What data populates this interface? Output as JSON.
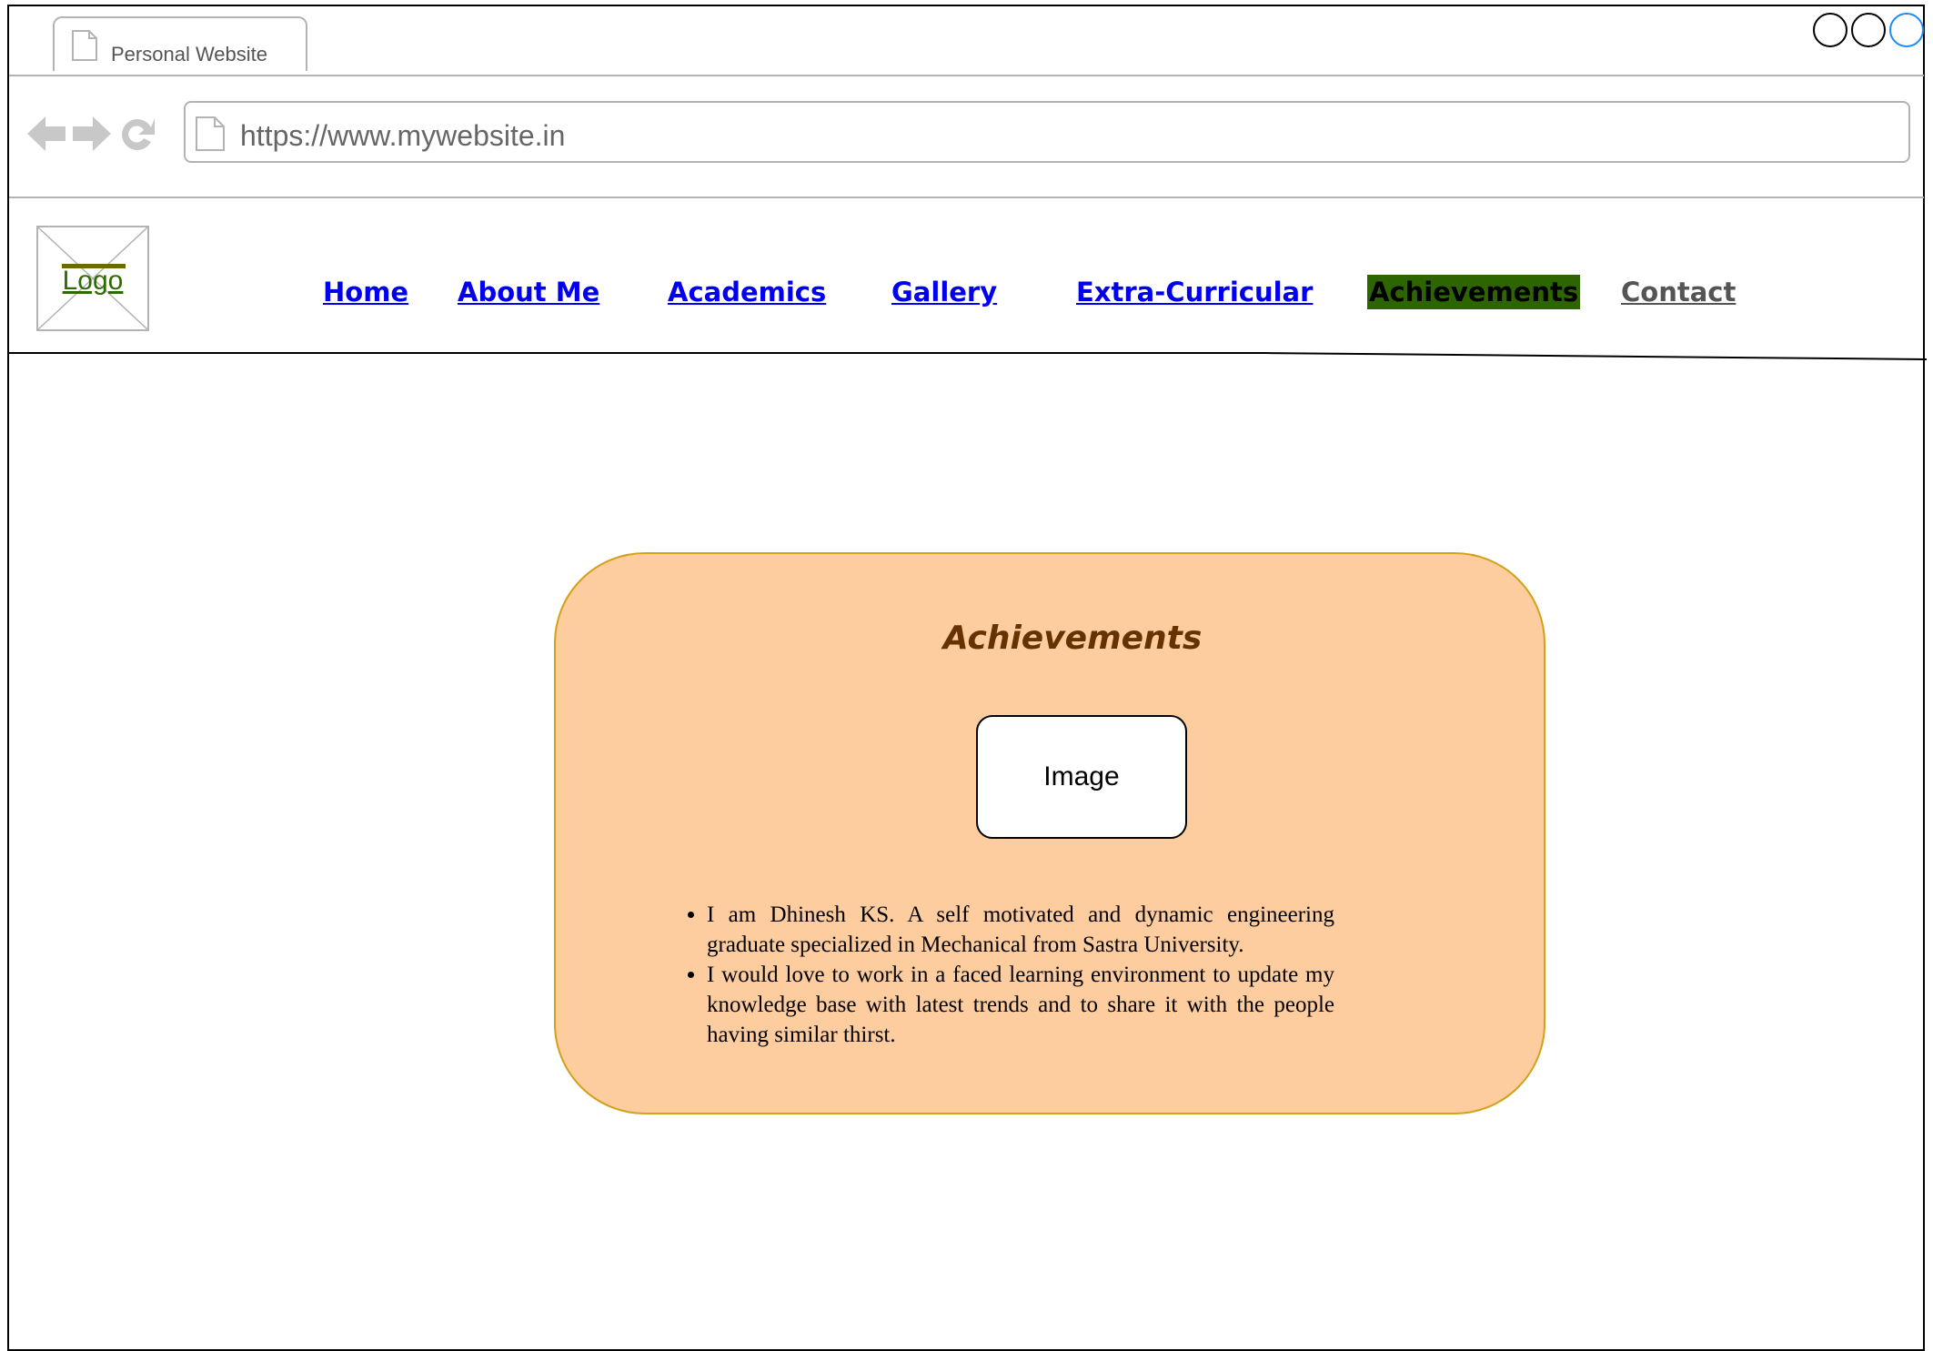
{
  "browser": {
    "tab_title": "Personal Website",
    "url": "https://www.mywebsite.in"
  },
  "site": {
    "logo_label": "Logo",
    "nav": [
      {
        "label": "Home"
      },
      {
        "label": "About Me"
      },
      {
        "label": "Academics"
      },
      {
        "label": "Gallery"
      },
      {
        "label": "Extra-Curricular"
      },
      {
        "label": "Achievements"
      },
      {
        "label": "Contact"
      }
    ]
  },
  "content": {
    "title": "Achievements",
    "image_placeholder": "Image",
    "bullets": [
      "I am Dhinesh KS. A self motivated and dynamic engineering graduate specialized in Mechanical from Sastra University.",
      "I would love to work in a faced learning environment to update my knowledge base with latest trends and to share it with the people having similar thirst."
    ]
  },
  "colors": {
    "card_fill": "#fdcc9f",
    "card_border": "#d4a017",
    "title_color": "#663300",
    "active_nav_bg": "#2d6600",
    "link_color": "#0000ee"
  }
}
